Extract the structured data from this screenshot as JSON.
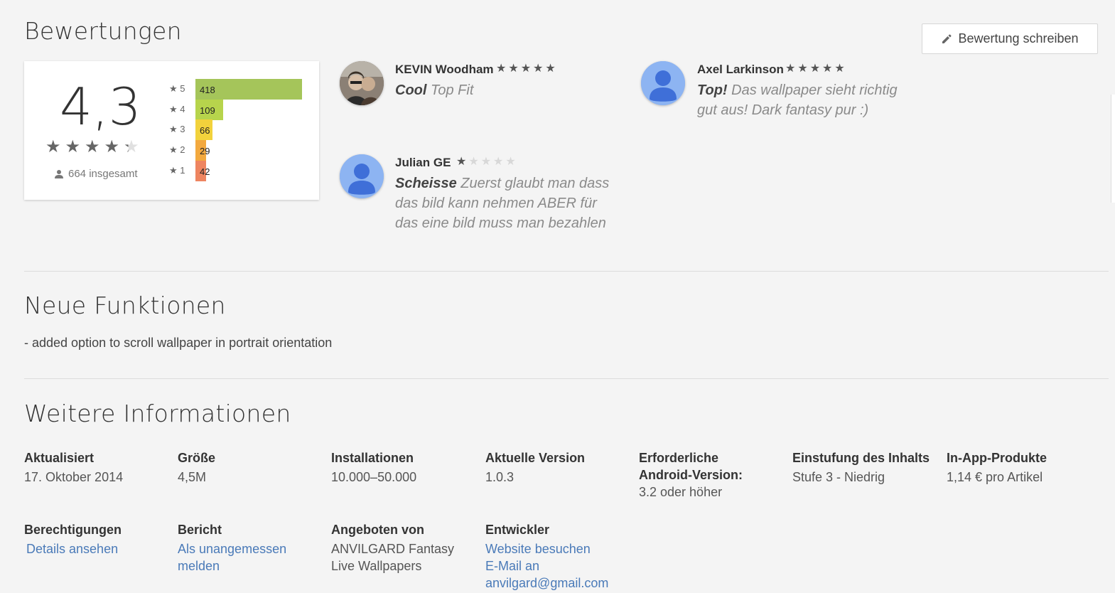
{
  "ratings_section": {
    "title": "Bewertungen",
    "write_review_label": "Bewertung schreiben",
    "average": "4,3",
    "average_star_fill": 4.3,
    "total_text": "664 insgesamt",
    "histogram": [
      {
        "stars": "5",
        "count": 418,
        "count_text": "418",
        "color": "#a5c55a"
      },
      {
        "stars": "4",
        "count": 109,
        "count_text": "109",
        "color": "#b7d44c"
      },
      {
        "stars": "3",
        "count": 66,
        "count_text": "66",
        "color": "#f2d23c"
      },
      {
        "stars": "2",
        "count": 29,
        "count_text": "29",
        "color": "#f3a93f"
      },
      {
        "stars": "1",
        "count": 42,
        "count_text": "42",
        "color": "#ee8560"
      }
    ]
  },
  "reviews": [
    {
      "name": "KEVIN Woodham",
      "rating": 5,
      "title": "Cool",
      "body": "Top Fit",
      "avatar": "photo"
    },
    {
      "name": "Axel Larkinson",
      "rating": 5,
      "title": "Top!",
      "body": "Das wallpaper sieht richtig gut aus! Dark fantasy pur :)",
      "avatar": "default-person-icon"
    },
    {
      "name": "Julian GE",
      "rating": 1,
      "title": "Scheisse",
      "body": "Zuerst glaubt man dass das bild kann nehmen ABER für das eine bild muss man bezahlen",
      "avatar": "default-person-icon"
    }
  ],
  "whats_new": {
    "title": "Neue Funktionen",
    "text": "- added option to scroll wallpaper in portrait orientation"
  },
  "more_info": {
    "title": "Weitere Informationen",
    "updated": {
      "label": "Aktualisiert",
      "value": "17. Oktober 2014"
    },
    "size": {
      "label": "Größe",
      "value": "4,5M"
    },
    "installs": {
      "label": "Installationen",
      "value": "10.000–50.000"
    },
    "version": {
      "label": "Aktuelle Version",
      "value": "1.0.3"
    },
    "android": {
      "label": "Erforderliche Android-Version:",
      "value": "3.2 oder höher"
    },
    "content_rating": {
      "label": "Einstufung des Inhalts",
      "value": "Stufe 3 - Niedrig"
    },
    "iap": {
      "label": "In-App-Produkte",
      "value": "1,14 € pro Artikel"
    },
    "permissions": {
      "label": "Berechtigungen",
      "link": "Details ansehen"
    },
    "report": {
      "label": "Bericht",
      "link": "Als unangemessen melden"
    },
    "offered_by": {
      "label": "Angeboten von",
      "value": "ANVILGARD Fantasy Live Wallpapers"
    },
    "developer": {
      "label": "Entwickler",
      "website_link": "Website besuchen",
      "email_link": "E-Mail an anvilgard@gmail.com"
    }
  },
  "colors": {
    "link": "#4a7ab8",
    "avatar_bg": "#8db4f2",
    "avatar_fg": "#3f6fd8"
  }
}
